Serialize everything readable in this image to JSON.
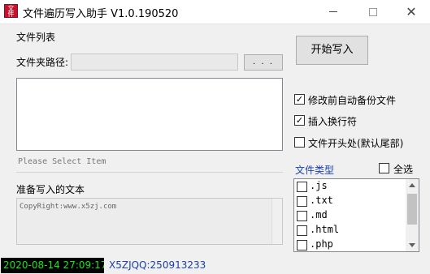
{
  "window": {
    "icon_glyph": "文件",
    "title": "文件遍历写入助手 V1.0.190520"
  },
  "file_list": {
    "group_label": "文件列表",
    "folder_label": "文件夹路径:",
    "folder_value": "",
    "browse_label": ". . .",
    "hint": "Please Select Item"
  },
  "write_text": {
    "label": "准备写入的文本",
    "value": "CopyRight:www.x5zj.com"
  },
  "actions": {
    "start_label": "开始写入"
  },
  "options": [
    {
      "label": "修改前自动备份文件",
      "checked": true
    },
    {
      "label": "插入换行符",
      "checked": true
    },
    {
      "label": "文件开头处(默认尾部)",
      "checked": false
    }
  ],
  "file_types": {
    "label": "文件类型",
    "select_all_label": "全选",
    "select_all_checked": false,
    "items": [
      {
        "label": ".js",
        "checked": false
      },
      {
        "label": ".txt",
        "checked": false
      },
      {
        "label": ".md",
        "checked": false
      },
      {
        "label": ".html",
        "checked": false
      },
      {
        "label": ".php",
        "checked": false
      }
    ]
  },
  "status": {
    "datetime": "2020-08-14 27:09:17",
    "contact": "X5ZJQQ:250913233"
  },
  "colors": {
    "clock_bg": "#000000",
    "clock_fg": "#1ee31e",
    "link_blue": "#1a3fa8",
    "icon_red": "#c8102e"
  }
}
